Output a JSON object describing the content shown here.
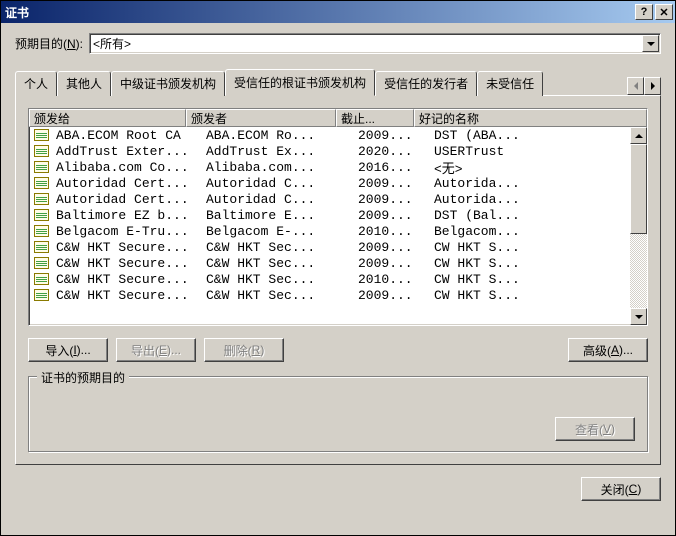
{
  "window": {
    "title": "证书"
  },
  "purpose": {
    "label_pre": "预期目的(",
    "label_key": "N",
    "label_post": "):",
    "value": "<所有>"
  },
  "tabs": [
    "个人",
    "其他人",
    "中级证书颁发机构",
    "受信任的根证书颁发机构",
    "受信任的发行者",
    "未受信任"
  ],
  "active_tab": 3,
  "columns": [
    "颁发给",
    "颁发者",
    "截止...",
    "好记的名称"
  ],
  "rows": [
    {
      "issued_to": "ABA.ECOM Root CA",
      "issued_by": "ABA.ECOM Ro...",
      "expires": "2009...",
      "friendly": "DST (ABA..."
    },
    {
      "issued_to": "AddTrust Exter...",
      "issued_by": "AddTrust Ex...",
      "expires": "2020...",
      "friendly": "USERTrust"
    },
    {
      "issued_to": "Alibaba.com Co...",
      "issued_by": "Alibaba.com...",
      "expires": "2016...",
      "friendly": "<无>"
    },
    {
      "issued_to": "Autoridad Cert...",
      "issued_by": "Autoridad C...",
      "expires": "2009...",
      "friendly": "Autorida..."
    },
    {
      "issued_to": "Autoridad Cert...",
      "issued_by": "Autoridad C...",
      "expires": "2009...",
      "friendly": "Autorida..."
    },
    {
      "issued_to": "Baltimore EZ b...",
      "issued_by": "Baltimore E...",
      "expires": "2009...",
      "friendly": "DST (Bal..."
    },
    {
      "issued_to": "Belgacom E-Tru...",
      "issued_by": "Belgacom E-...",
      "expires": "2010...",
      "friendly": "Belgacom..."
    },
    {
      "issued_to": "C&W HKT Secure...",
      "issued_by": "C&W HKT Sec...",
      "expires": "2009...",
      "friendly": "CW HKT S..."
    },
    {
      "issued_to": "C&W HKT Secure...",
      "issued_by": "C&W HKT Sec...",
      "expires": "2009...",
      "friendly": "CW HKT S..."
    },
    {
      "issued_to": "C&W HKT Secure...",
      "issued_by": "C&W HKT Sec...",
      "expires": "2010...",
      "friendly": "CW HKT S..."
    },
    {
      "issued_to": "C&W HKT Secure...",
      "issued_by": "C&W HKT Sec...",
      "expires": "2009...",
      "friendly": "CW HKT S..."
    }
  ],
  "buttons": {
    "import_pre": "导入(",
    "import_key": "I",
    "import_post": ")...",
    "export_pre": "导出(",
    "export_key": "E",
    "export_post": ")...",
    "delete_pre": "删除(",
    "delete_key": "R",
    "delete_post": ")",
    "advanced_pre": "高级(",
    "advanced_key": "A",
    "advanced_post": ")...",
    "view_pre": "查看(",
    "view_key": "V",
    "view_post": ")",
    "close_pre": "关闭(",
    "close_key": "C",
    "close_post": ")"
  },
  "group_title": "证书的预期目的"
}
